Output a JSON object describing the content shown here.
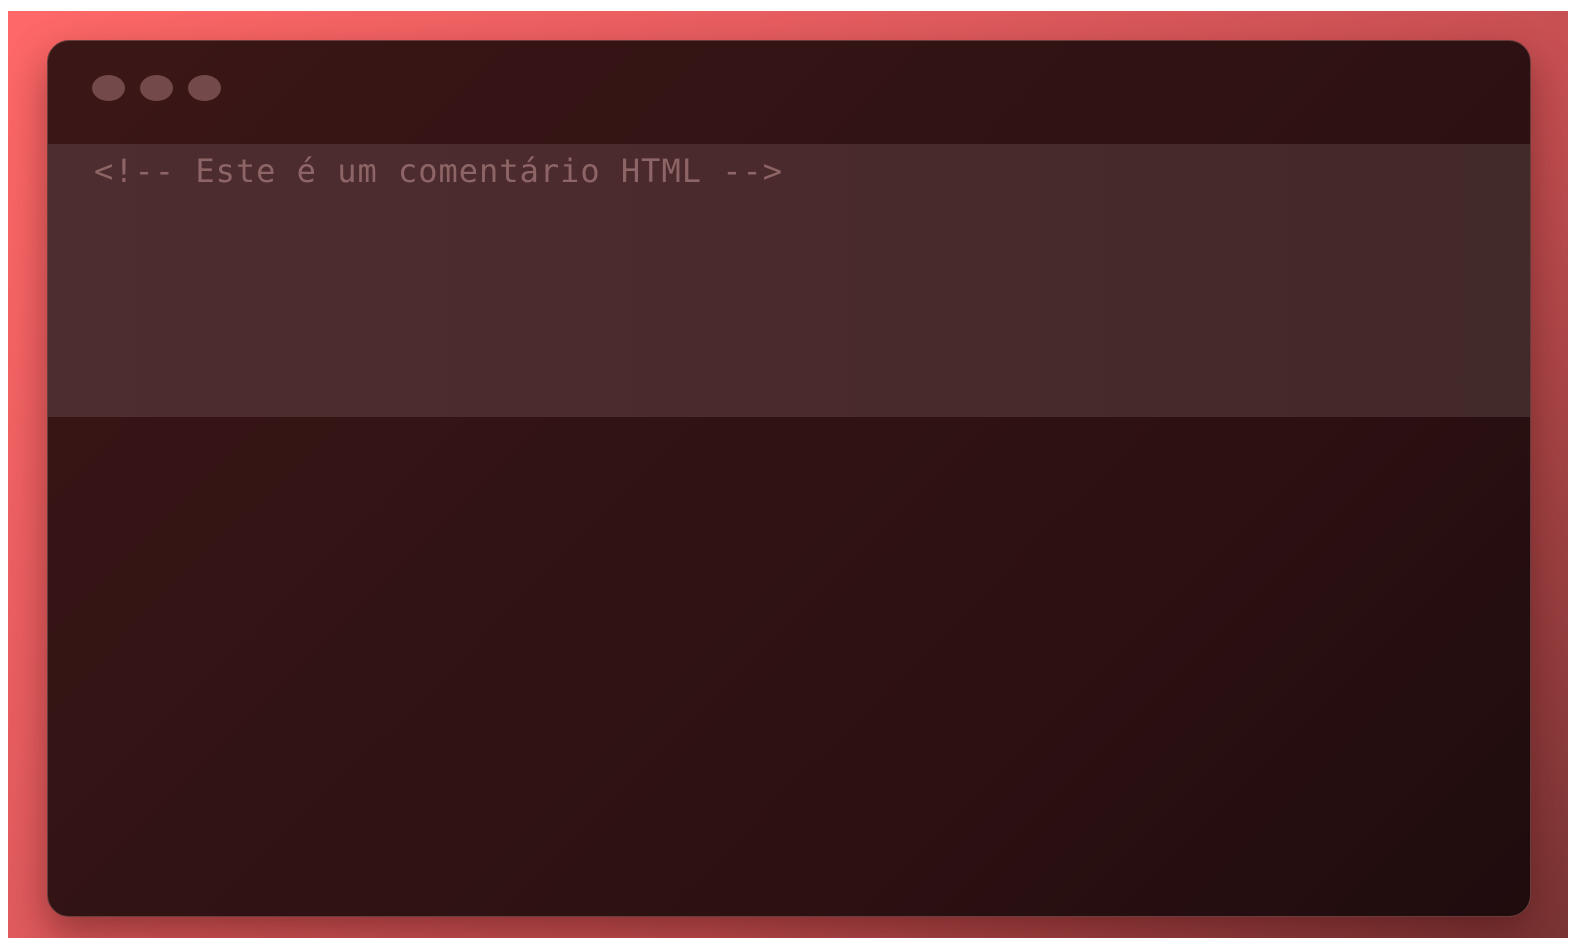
{
  "window": {
    "controls": [
      {
        "icon": "window-control-dot-icon"
      },
      {
        "icon": "window-control-dot-icon"
      },
      {
        "icon": "window-control-dot-icon"
      }
    ]
  },
  "editor": {
    "lines": [
      "<!-- Este é um comentário HTML -->"
    ]
  },
  "colors": {
    "background_accent": "#ff6868",
    "window_background": "#321314",
    "editor_highlight": "#4a2a2c",
    "comment_text": "#8e6566",
    "control_dot": "#74494a"
  }
}
